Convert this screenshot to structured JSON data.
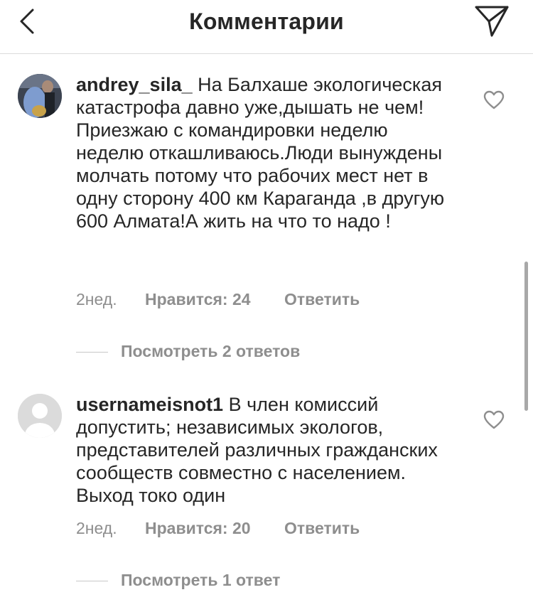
{
  "header": {
    "title": "Комментарии",
    "back_icon": "chevron-left-icon",
    "share_icon": "paper-plane-icon"
  },
  "comments": [
    {
      "username": "andrey_sila_",
      "text": "На Балхаше экологическая катастрофа давно уже,дышать не чем!Приезжаю с командировки неделю неделю откашливаюсь.Люди вынуждены молчать потому что рабочих мест нет в одну сторону 400 км Караганда ,в другую 600 Алмата!А жить на что то надо !",
      "time": "2нед.",
      "likes": "Нравится: 24",
      "reply": "Ответить",
      "view_replies": "Посмотреть 2 ответов",
      "avatar": "user-photo"
    },
    {
      "username": "usernameisnot1",
      "text": "В член комиссий допустить; независимых экологов, представителей различных гражданских сообществ совместно с населением. Выход токо один",
      "time": "2нед.",
      "likes": "Нравится: 20",
      "reply": "Ответить",
      "view_replies": "Посмотреть 1 ответ",
      "avatar": "default-avatar"
    }
  ],
  "colors": {
    "text": "#262626",
    "secondary": "#8e8e8e",
    "divider": "#dbdbdb"
  }
}
